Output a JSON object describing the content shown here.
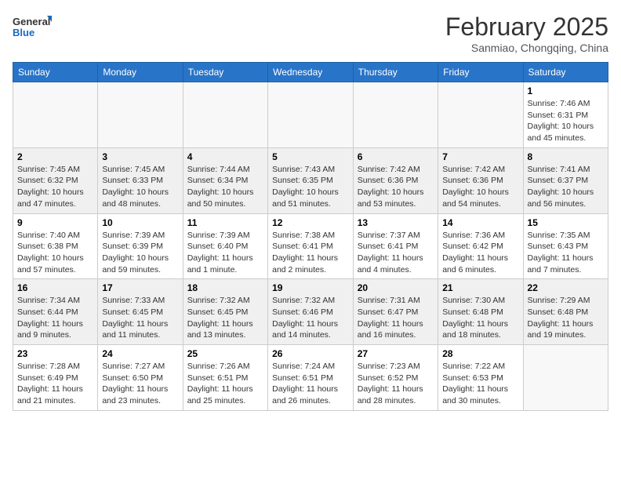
{
  "header": {
    "logo_general": "General",
    "logo_blue": "Blue",
    "month_title": "February 2025",
    "location": "Sanmiao, Chongqing, China"
  },
  "weekdays": [
    "Sunday",
    "Monday",
    "Tuesday",
    "Wednesday",
    "Thursday",
    "Friday",
    "Saturday"
  ],
  "weeks": [
    [
      {
        "day": "",
        "info": ""
      },
      {
        "day": "",
        "info": ""
      },
      {
        "day": "",
        "info": ""
      },
      {
        "day": "",
        "info": ""
      },
      {
        "day": "",
        "info": ""
      },
      {
        "day": "",
        "info": ""
      },
      {
        "day": "1",
        "info": "Sunrise: 7:46 AM\nSunset: 6:31 PM\nDaylight: 10 hours and 45 minutes."
      }
    ],
    [
      {
        "day": "2",
        "info": "Sunrise: 7:45 AM\nSunset: 6:32 PM\nDaylight: 10 hours and 47 minutes."
      },
      {
        "day": "3",
        "info": "Sunrise: 7:45 AM\nSunset: 6:33 PM\nDaylight: 10 hours and 48 minutes."
      },
      {
        "day": "4",
        "info": "Sunrise: 7:44 AM\nSunset: 6:34 PM\nDaylight: 10 hours and 50 minutes."
      },
      {
        "day": "5",
        "info": "Sunrise: 7:43 AM\nSunset: 6:35 PM\nDaylight: 10 hours and 51 minutes."
      },
      {
        "day": "6",
        "info": "Sunrise: 7:42 AM\nSunset: 6:36 PM\nDaylight: 10 hours and 53 minutes."
      },
      {
        "day": "7",
        "info": "Sunrise: 7:42 AM\nSunset: 6:36 PM\nDaylight: 10 hours and 54 minutes."
      },
      {
        "day": "8",
        "info": "Sunrise: 7:41 AM\nSunset: 6:37 PM\nDaylight: 10 hours and 56 minutes."
      }
    ],
    [
      {
        "day": "9",
        "info": "Sunrise: 7:40 AM\nSunset: 6:38 PM\nDaylight: 10 hours and 57 minutes."
      },
      {
        "day": "10",
        "info": "Sunrise: 7:39 AM\nSunset: 6:39 PM\nDaylight: 10 hours and 59 minutes."
      },
      {
        "day": "11",
        "info": "Sunrise: 7:39 AM\nSunset: 6:40 PM\nDaylight: 11 hours and 1 minute."
      },
      {
        "day": "12",
        "info": "Sunrise: 7:38 AM\nSunset: 6:41 PM\nDaylight: 11 hours and 2 minutes."
      },
      {
        "day": "13",
        "info": "Sunrise: 7:37 AM\nSunset: 6:41 PM\nDaylight: 11 hours and 4 minutes."
      },
      {
        "day": "14",
        "info": "Sunrise: 7:36 AM\nSunset: 6:42 PM\nDaylight: 11 hours and 6 minutes."
      },
      {
        "day": "15",
        "info": "Sunrise: 7:35 AM\nSunset: 6:43 PM\nDaylight: 11 hours and 7 minutes."
      }
    ],
    [
      {
        "day": "16",
        "info": "Sunrise: 7:34 AM\nSunset: 6:44 PM\nDaylight: 11 hours and 9 minutes."
      },
      {
        "day": "17",
        "info": "Sunrise: 7:33 AM\nSunset: 6:45 PM\nDaylight: 11 hours and 11 minutes."
      },
      {
        "day": "18",
        "info": "Sunrise: 7:32 AM\nSunset: 6:45 PM\nDaylight: 11 hours and 13 minutes."
      },
      {
        "day": "19",
        "info": "Sunrise: 7:32 AM\nSunset: 6:46 PM\nDaylight: 11 hours and 14 minutes."
      },
      {
        "day": "20",
        "info": "Sunrise: 7:31 AM\nSunset: 6:47 PM\nDaylight: 11 hours and 16 minutes."
      },
      {
        "day": "21",
        "info": "Sunrise: 7:30 AM\nSunset: 6:48 PM\nDaylight: 11 hours and 18 minutes."
      },
      {
        "day": "22",
        "info": "Sunrise: 7:29 AM\nSunset: 6:48 PM\nDaylight: 11 hours and 19 minutes."
      }
    ],
    [
      {
        "day": "23",
        "info": "Sunrise: 7:28 AM\nSunset: 6:49 PM\nDaylight: 11 hours and 21 minutes."
      },
      {
        "day": "24",
        "info": "Sunrise: 7:27 AM\nSunset: 6:50 PM\nDaylight: 11 hours and 23 minutes."
      },
      {
        "day": "25",
        "info": "Sunrise: 7:26 AM\nSunset: 6:51 PM\nDaylight: 11 hours and 25 minutes."
      },
      {
        "day": "26",
        "info": "Sunrise: 7:24 AM\nSunset: 6:51 PM\nDaylight: 11 hours and 26 minutes."
      },
      {
        "day": "27",
        "info": "Sunrise: 7:23 AM\nSunset: 6:52 PM\nDaylight: 11 hours and 28 minutes."
      },
      {
        "day": "28",
        "info": "Sunrise: 7:22 AM\nSunset: 6:53 PM\nDaylight: 11 hours and 30 minutes."
      },
      {
        "day": "",
        "info": ""
      }
    ]
  ]
}
